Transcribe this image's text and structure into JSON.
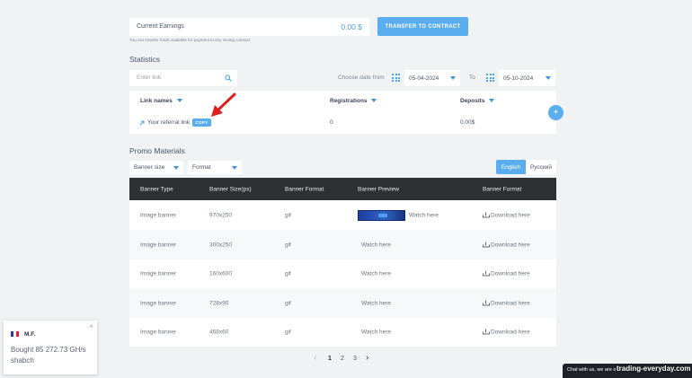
{
  "earnings": {
    "label": "Current Earnings",
    "value": "0.00 $",
    "button": "TRANSFER TO CONTRACT",
    "note": "You can transfer funds available for payment to any mining contract"
  },
  "statistics": {
    "title": "Statistics",
    "search_placeholder": "Enter link",
    "date_from_label": "Choose date from",
    "date_from": "05-04-2024",
    "date_to_label": "To",
    "date_to": "05-10-2024",
    "columns": [
      "Link names",
      "Registrations",
      "Deposits"
    ],
    "row": {
      "link": "Your referral link",
      "copy": "COPY",
      "registrations": "0",
      "deposits": "0.00$"
    },
    "add_symbol": "+"
  },
  "promo": {
    "title": "Promo Materials",
    "banner_size_filter": "Banner size",
    "format_filter": "Format",
    "languages": [
      "English",
      "Русский"
    ],
    "headers": [
      "Banner Type",
      "Banner Size(px)",
      "Banner Format",
      "Banner Preview",
      "Banner Format"
    ],
    "rows": [
      {
        "type": "Image banner",
        "size": "970x250",
        "format": "gif",
        "preview": "Watch here",
        "download": "Download here"
      },
      {
        "type": "Image banner",
        "size": "300x250",
        "format": "gif",
        "preview": "Watch here",
        "download": "Download here"
      },
      {
        "type": "Image banner",
        "size": "160x600",
        "format": "gif",
        "preview": "Watch here",
        "download": "Download here"
      },
      {
        "type": "Image banner",
        "size": "728x90",
        "format": "gif",
        "preview": "Watch here",
        "download": "Download here"
      },
      {
        "type": "Image banner",
        "size": "468x60",
        "format": "gif",
        "preview": "Watch here",
        "download": "Download here"
      }
    ],
    "pagination": {
      "prev": "‹",
      "pages": [
        "1",
        "2",
        "3"
      ],
      "next": "›"
    }
  },
  "notification": {
    "name": "M.F.",
    "text_line1": "Bought 85 272.73 GH/s",
    "text_line2": "shabch",
    "close": "×"
  },
  "chat": {
    "text": "Chat with us, we are o"
  },
  "watermark": "trading-everyday.com",
  "colors": {
    "accent": "#4aa3ef",
    "header_dark": "#2f3033",
    "arrow": "#e0201c"
  },
  "icons": {
    "search": "search-icon",
    "calendar": "calendar-grid-icon",
    "arrow": "diagonal-arrow-icon",
    "download": "download-icon"
  }
}
